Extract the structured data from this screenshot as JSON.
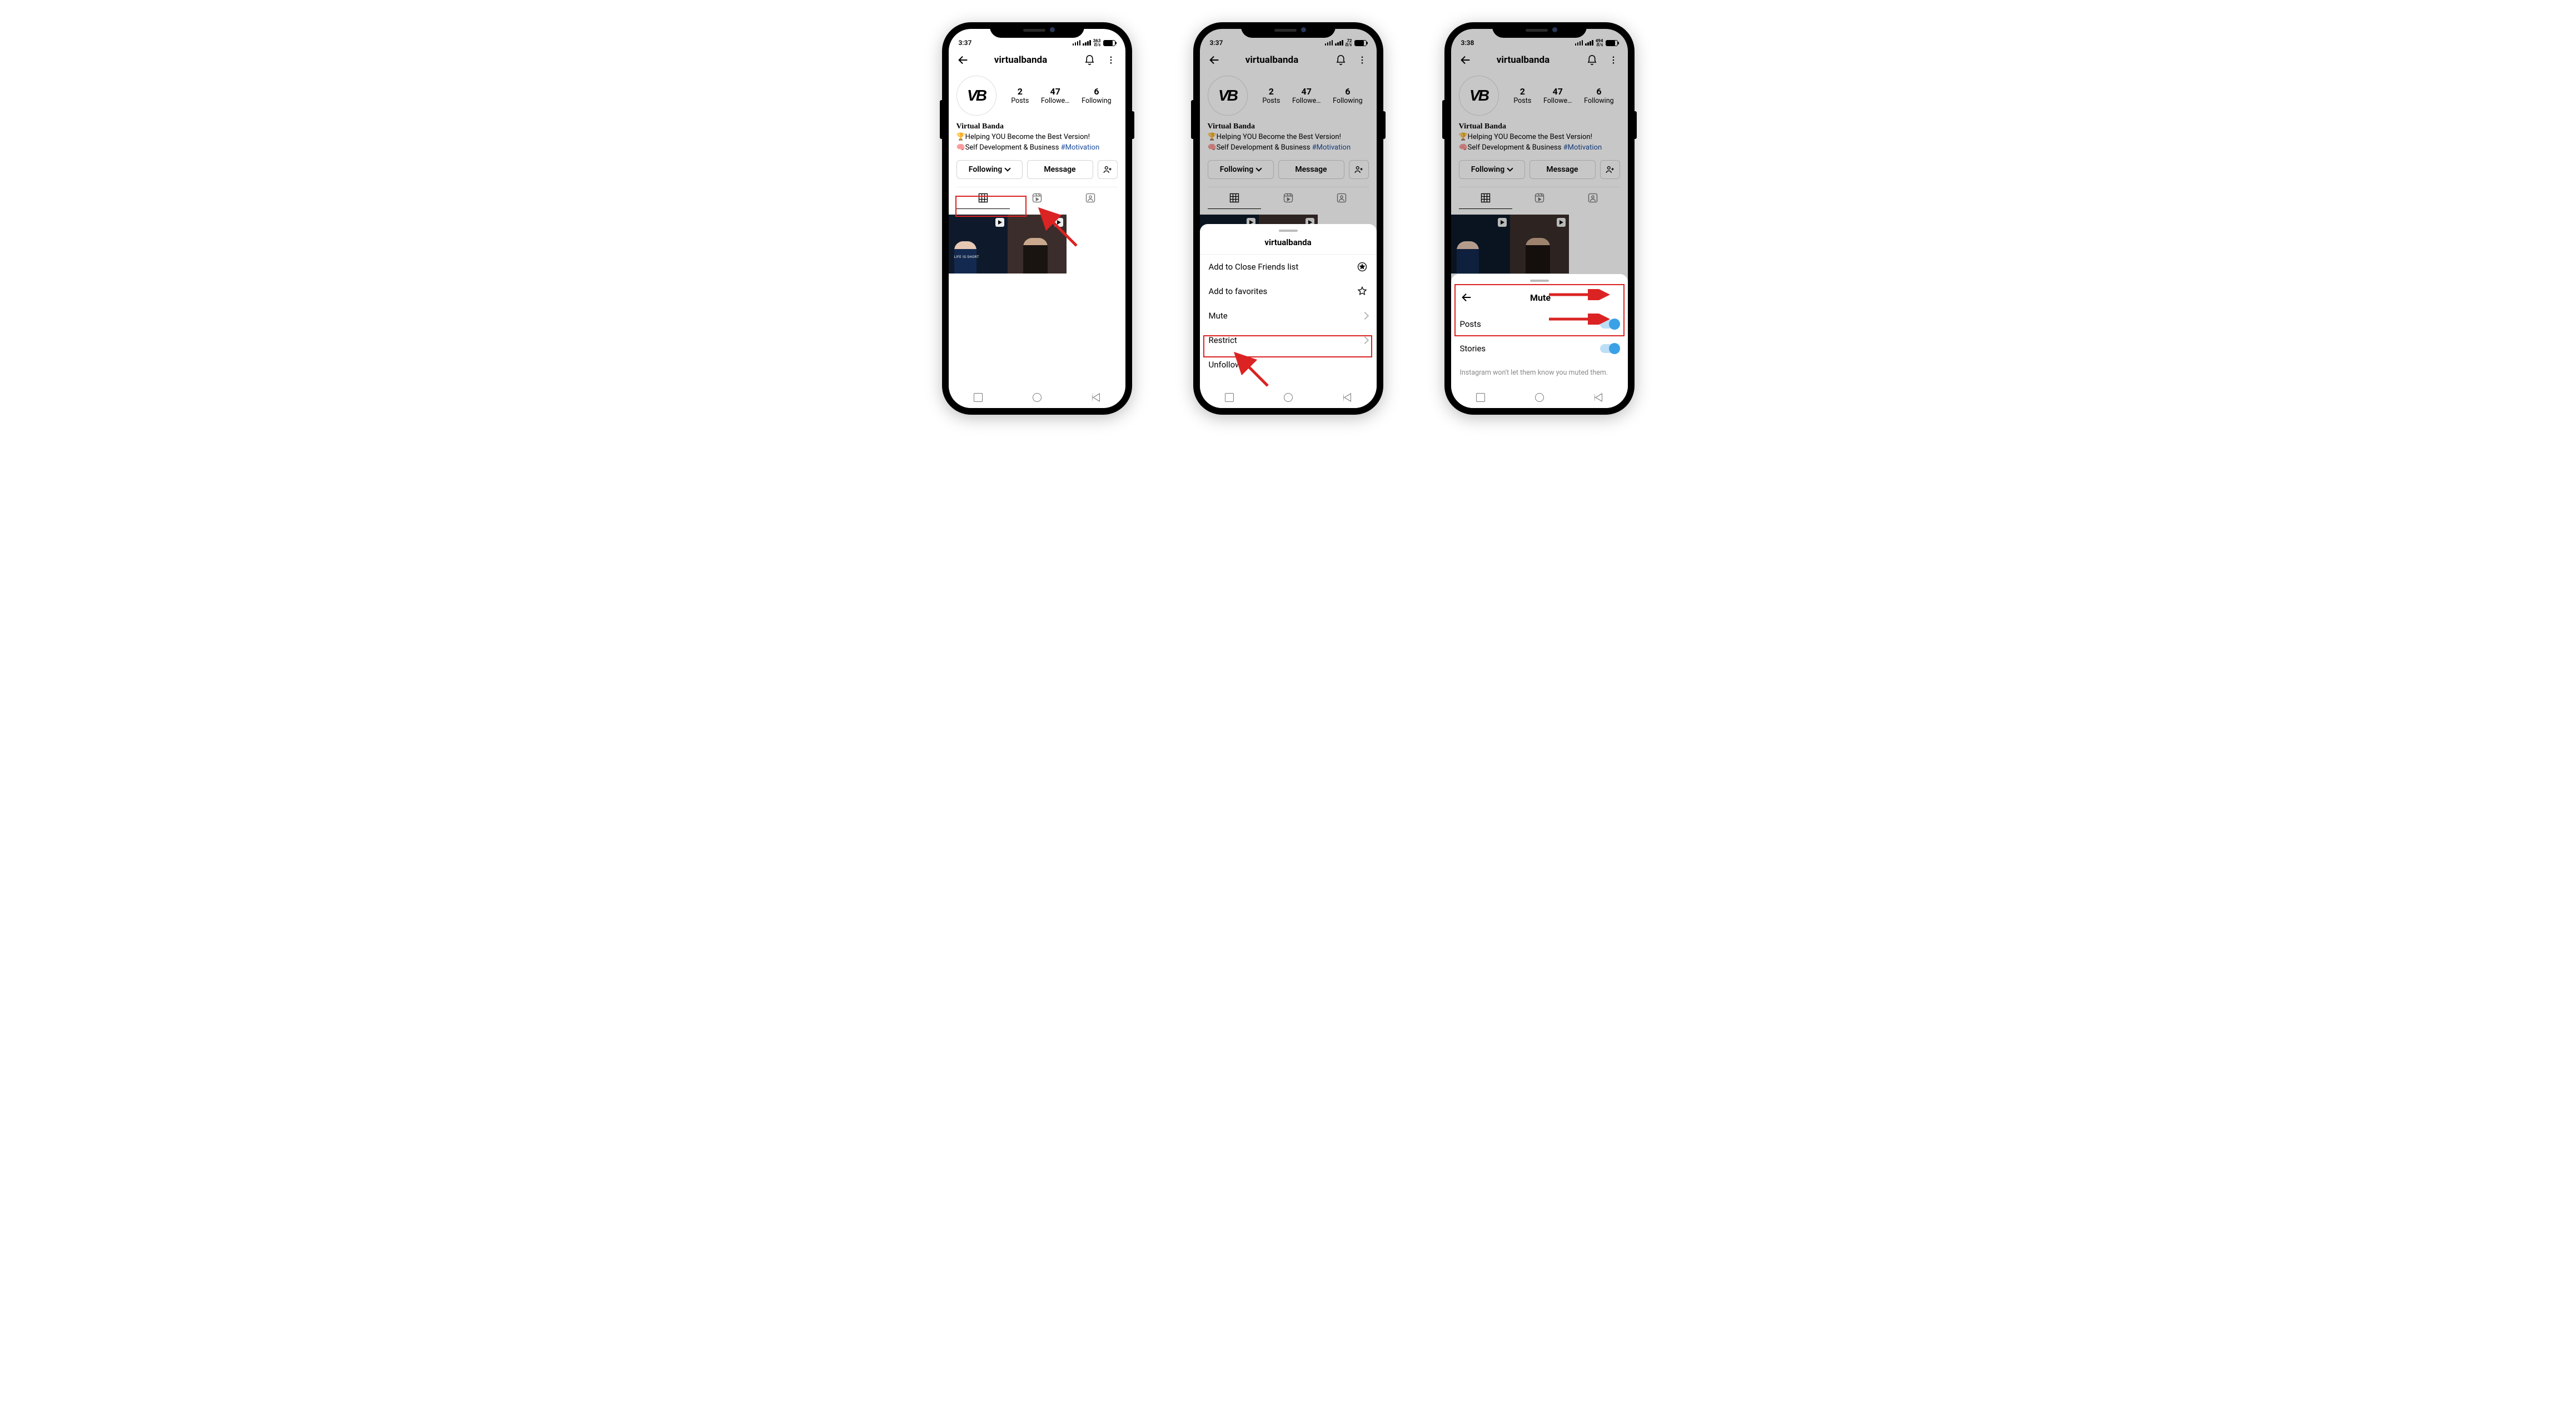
{
  "status": {
    "time1": "3:37",
    "time2": "3:37",
    "time3": "3:38",
    "rate1_up": "363",
    "rate2_up": "72",
    "rate3_up": "494",
    "rate_unit": "B/s"
  },
  "page": {
    "username": "virtualbanda",
    "avatar_text": "VB",
    "stats": {
      "posts": {
        "n": "2",
        "label": "Posts"
      },
      "followers": {
        "n": "47",
        "label": "Followe…"
      },
      "following": {
        "n": "6",
        "label": "Following"
      }
    },
    "bio": {
      "name": "Virtual Banda",
      "line1_pre": "🏆Helping YOU Become the Best Version!",
      "line2_pre": "🧠Self Development & Business ",
      "hashtag": "#Motivation"
    },
    "buttons": {
      "following": "Following",
      "message": "Message"
    },
    "thumb_caption": "LIFE IS SHORT"
  },
  "sheet_follow": {
    "title": "virtualbanda",
    "items": {
      "close_friends": "Add to Close Friends list",
      "favorites": "Add to favorites",
      "mute": "Mute",
      "restrict": "Restrict",
      "unfollow": "Unfollow"
    }
  },
  "sheet_mute": {
    "title": "Mute",
    "posts": "Posts",
    "stories": "Stories",
    "note": "Instagram won't let them know you muted them."
  }
}
